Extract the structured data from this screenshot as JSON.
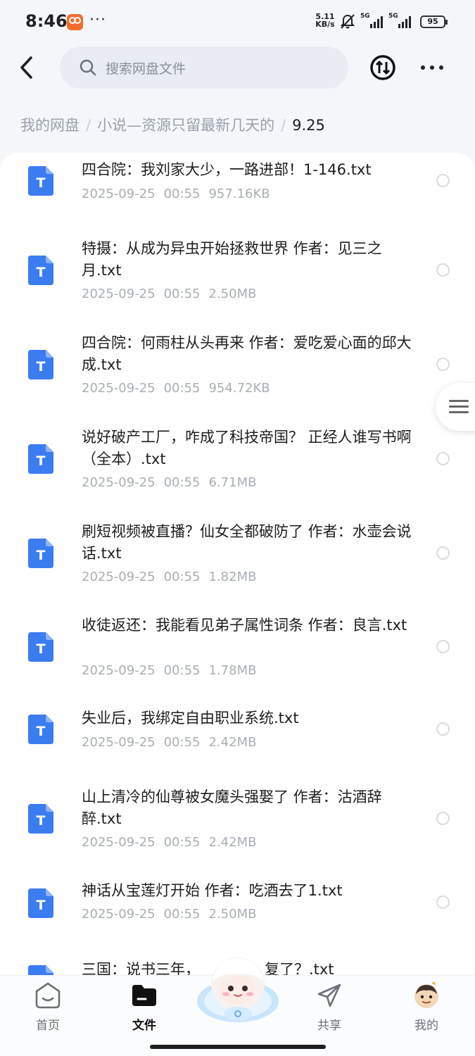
{
  "status_bar": {
    "time": "8:46",
    "dots": "···",
    "net_speed_value": "5.11",
    "net_speed_unit": "KB/s",
    "signal1_label": "5G",
    "signal2_label": "5G",
    "battery": "95"
  },
  "header": {
    "search_placeholder": "搜索网盘文件",
    "back_icon": "chevron-left-icon",
    "transfer_icon": "transfer-icon",
    "more_icon": "more-dots-icon"
  },
  "breadcrumb": {
    "items": [
      "我的网盘",
      "小说—资源只留最新几天的"
    ],
    "separator": "/",
    "current": "9.25"
  },
  "files": [
    {
      "name": "四合院：我刘家大少，一路进部！1-146.txt",
      "date": "2025-09-25",
      "time": "00:55",
      "size": "957.16KB"
    },
    {
      "name": "特摄：从成为异虫开始拯救世界 作者：见三之月.txt",
      "date": "2025-09-25",
      "time": "00:55",
      "size": "2.50MB"
    },
    {
      "name": "四合院：何雨柱从头再来 作者：爱吃爱心面的邱大成.txt",
      "date": "2025-09-25",
      "time": "00:55",
      "size": "954.72KB"
    },
    {
      "name": "说好破产工厂，咋成了科技帝国？ 正经人谁写书啊（全本）.txt",
      "date": "2025-09-25",
      "time": "00:55",
      "size": "6.71MB"
    },
    {
      "name": "刷短视频被直播？仙女全都破防了 作者：水壶会说话.txt",
      "date": "2025-09-25",
      "time": "00:55",
      "size": "1.82MB"
    },
    {
      "name": "收徒返还：我能看见弟子属性词条 作者：良言.txt",
      "date": "2025-09-25",
      "time": "00:55",
      "size": "1.78MB"
    },
    {
      "name": "失业后，我绑定自由职业系统.txt",
      "date": "2025-09-25",
      "time": "00:55",
      "size": "2.42MB"
    },
    {
      "name": "山上清冷的仙尊被女魔头强娶了 作者：沽酒辞醉.txt",
      "date": "2025-09-25",
      "time": "00:55",
      "size": "2.42MB"
    },
    {
      "name": "神话从宝莲灯开始 作者：吃酒去了1.txt",
      "date": "2025-09-25",
      "time": "00:55",
      "size": "2.50MB"
    },
    {
      "name": "三国：说书三年，",
      "name_tail": "复了？.txt",
      "date": "",
      "time": "",
      "size": ""
    }
  ],
  "file_icon_letter": "T",
  "colors": {
    "accent": "#3b7cf0",
    "background": "#f4f6fa",
    "card": "#ffffff",
    "meta_text": "#a9aeb6"
  },
  "bottom_nav": {
    "items": [
      {
        "label": "首页",
        "icon": "home-face-icon",
        "active": false
      },
      {
        "label": "文件",
        "icon": "folder-icon",
        "active": true
      },
      {
        "label": "共享",
        "icon": "paper-plane-icon",
        "active": false
      },
      {
        "label": "我的",
        "icon": "avatar-icon",
        "active": false
      }
    ],
    "center_icon": "ai-assistant-mascot-icon"
  }
}
